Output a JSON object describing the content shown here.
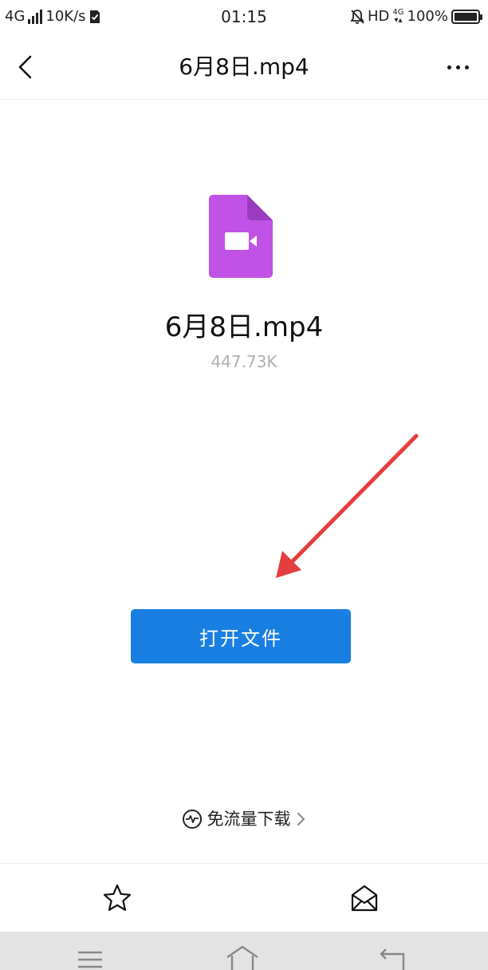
{
  "status_bar": {
    "network": "4G",
    "speed": "10K/s",
    "time": "01:15",
    "hd": "HD",
    "network2": "4G",
    "battery": "100%"
  },
  "header": {
    "title": "6月8日.mp4",
    "back_icon": "chevron-left-icon",
    "more_icon": "more-horizontal-icon"
  },
  "file": {
    "icon": "video-file-icon",
    "icon_color": "#c152e6",
    "name": "6月8日.mp4",
    "size": "447.73K"
  },
  "open_button": {
    "label": "打开文件",
    "color": "#1a7fe3"
  },
  "free_download": {
    "label": "免流量下载",
    "icon": "pulse-icon"
  },
  "action_bar": {
    "items": [
      {
        "icon": "star-icon"
      },
      {
        "icon": "envelope-open-icon"
      }
    ]
  },
  "system_nav": {
    "items": [
      {
        "icon": "menu-icon"
      },
      {
        "icon": "home-icon"
      },
      {
        "icon": "back-icon"
      }
    ]
  },
  "annotation": {
    "icon": "red-arrow-icon",
    "color": "#e53e3e"
  }
}
